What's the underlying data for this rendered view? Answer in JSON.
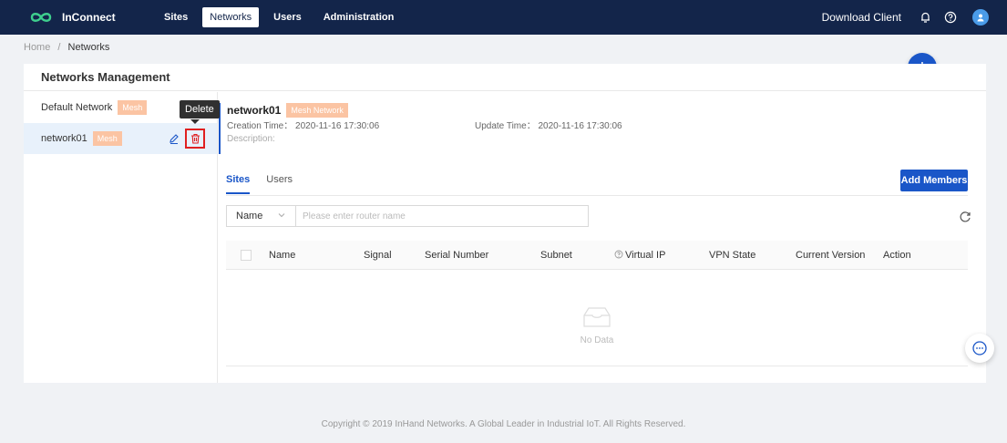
{
  "colors": {
    "navbar": "#13254a",
    "primary": "#1a56c8",
    "badge": "#fbc4a3",
    "highlight": "#e02020"
  },
  "header": {
    "logo_text": "InConnect",
    "nav": [
      {
        "label": "Sites"
      },
      {
        "label": "Networks",
        "active": true
      },
      {
        "label": "Users"
      },
      {
        "label": "Administration"
      }
    ],
    "download_label": "Download Client",
    "icons": [
      "bell-icon",
      "help-icon",
      "user-icon"
    ]
  },
  "breadcrumb": {
    "home": "Home",
    "separator": "/",
    "current": "Networks"
  },
  "card": {
    "title": "Networks Management"
  },
  "networks": [
    {
      "name": "Default Network",
      "badge": "Mesh"
    },
    {
      "name": "network01",
      "badge": "Mesh",
      "selected": true
    }
  ],
  "tooltip": "Delete",
  "detail": {
    "name": "network01",
    "type_badge": "Mesh Network",
    "creation_label": "Creation Time",
    "creation_time": "2020-11-16 17:30:06",
    "update_label": "Update Time",
    "update_time": "2020-11-16 17:30:06",
    "description_label": "Description:"
  },
  "tabs": [
    {
      "label": "Sites",
      "active": true
    },
    {
      "label": "Users"
    }
  ],
  "add_members_label": "Add Members",
  "filter": {
    "field": "Name",
    "placeholder": "Please enter router name"
  },
  "table": {
    "columns": [
      "Name",
      "Signal",
      "Serial Number",
      "Subnet",
      "Virtual IP",
      "VPN State",
      "Current Version",
      "Action"
    ],
    "empty_text": "No Data"
  },
  "fab_label": "+",
  "footer": "Copyright © 2019 InHand Networks. A Global Leader in Industrial IoT. All Rights Reserved."
}
